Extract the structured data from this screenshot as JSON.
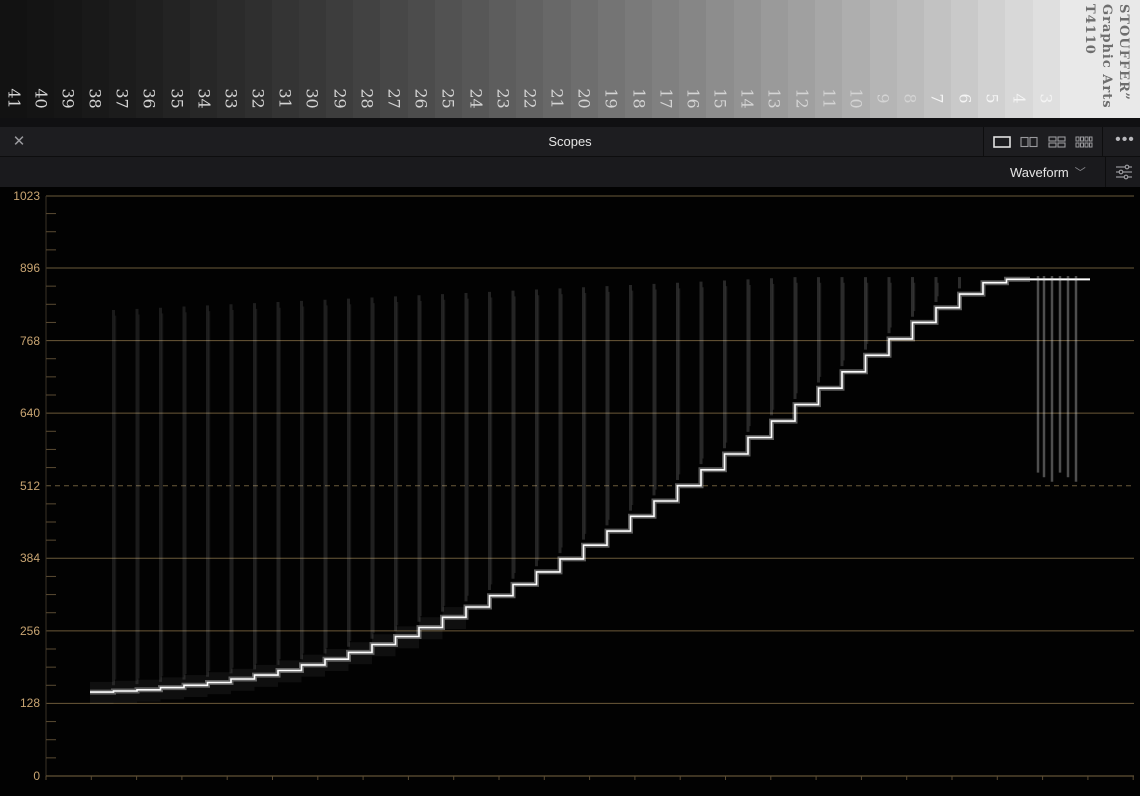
{
  "step_wedge": {
    "numbers": [
      "41",
      "40",
      "39",
      "38",
      "37",
      "36",
      "35",
      "34",
      "33",
      "32",
      "31",
      "30",
      "29",
      "28",
      "27",
      "26",
      "25",
      "24",
      "23",
      "22",
      "21",
      "20",
      "19",
      "18",
      "17",
      "16",
      "15",
      "14",
      "13",
      "12",
      "11",
      "10",
      "9",
      "8",
      "7",
      "6",
      "5",
      "4",
      "3"
    ],
    "brand_lines": [
      "STOUFFER”",
      "Graphic Arts",
      "T4110"
    ]
  },
  "scopes_panel": {
    "title": "Scopes",
    "close_icon": "close-icon",
    "layout_icons": [
      "layout-1up-icon",
      "layout-2up-icon",
      "layout-2x2-icon",
      "layout-4up-icon"
    ],
    "more_icon": "more-options-icon",
    "scope_type": "Waveform",
    "settings_icon": "settings-sliders-icon"
  },
  "waveform": {
    "scale_labels": [
      "1023",
      "896",
      "768",
      "640",
      "512",
      "384",
      "256",
      "128",
      "0"
    ],
    "scale_values": [
      1023,
      896,
      768,
      640,
      512,
      384,
      256,
      128,
      0
    ],
    "dashed_level": 512,
    "trace_color": "#ffffff",
    "gridline_color": "#6b5a3a",
    "label_color": "#c9a572",
    "step_levels": [
      148,
      150,
      152,
      156,
      160,
      165,
      171,
      178,
      186,
      196,
      206,
      218,
      232,
      246,
      262,
      280,
      298,
      318,
      338,
      360,
      383,
      407,
      432,
      458,
      485,
      512,
      540,
      568,
      597,
      626,
      655,
      684,
      713,
      742,
      771,
      800,
      826,
      850,
      870,
      876
    ]
  }
}
